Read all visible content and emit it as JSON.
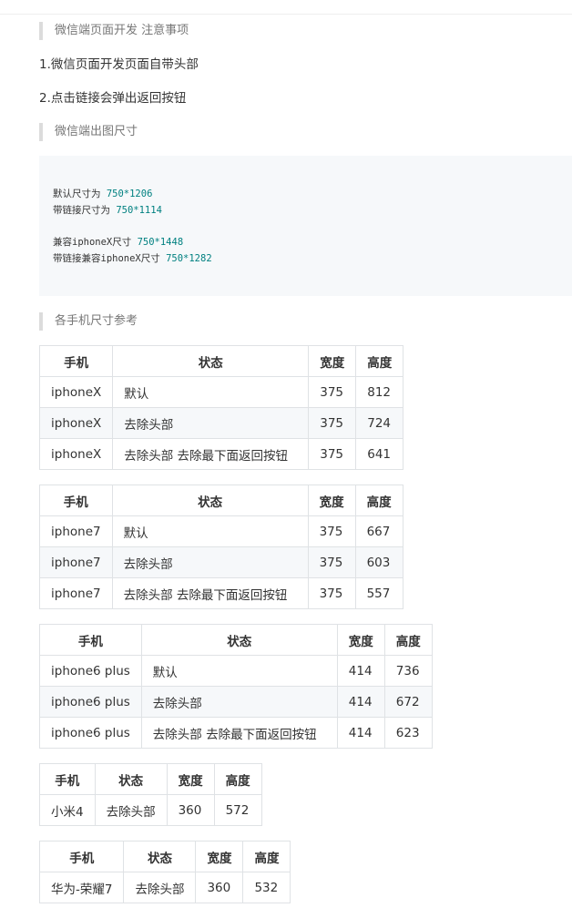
{
  "notes_title": "微信端页面开发 注意事项",
  "note1": "1.微信页面开发页面自带头部",
  "note2": "2.点击链接会弹出返回按钮",
  "size_title": "微信端出图尺寸",
  "code": [
    {
      "label": "默认尺寸为 ",
      "value": "750*1206"
    },
    {
      "label": "带链接尺寸为 ",
      "value": "750*1114"
    },
    {
      "label": "兼容iphoneX尺寸 ",
      "value": "750*1448"
    },
    {
      "label": "带链接兼容iphoneX尺寸 ",
      "value": "750*1282"
    }
  ],
  "phones_title": "各手机尺寸参考",
  "headers": [
    "手机",
    "状态",
    "宽度",
    "高度"
  ],
  "tables": [
    {
      "rows": [
        [
          "iphoneX",
          "默认",
          "375",
          "812"
        ],
        [
          "iphoneX",
          "去除头部",
          "375",
          "724"
        ],
        [
          "iphoneX",
          "去除头部 去除最下面返回按钮",
          "375",
          "641"
        ]
      ]
    },
    {
      "rows": [
        [
          "iphone7",
          "默认",
          "375",
          "667"
        ],
        [
          "iphone7",
          "去除头部",
          "375",
          "603"
        ],
        [
          "iphone7",
          "去除头部 去除最下面返回按钮",
          "375",
          "557"
        ]
      ]
    },
    {
      "rows": [
        [
          "iphone6 plus",
          "默认",
          "414",
          "736"
        ],
        [
          "iphone6 plus",
          "去除头部",
          "414",
          "672"
        ],
        [
          "iphone6 plus",
          "去除头部 去除最下面返回按钮",
          "414",
          "623"
        ]
      ]
    },
    {
      "rows": [
        [
          "小米4",
          "去除头部",
          "360",
          "572"
        ]
      ]
    },
    {
      "rows": [
        [
          "华为-荣耀7",
          "去除头部",
          "360",
          "532"
        ]
      ]
    }
  ]
}
